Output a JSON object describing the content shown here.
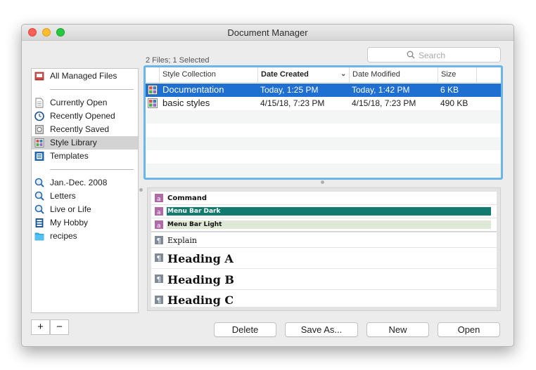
{
  "window": {
    "title": "Document Manager"
  },
  "search": {
    "placeholder": "Search"
  },
  "file_count": "2 Files; 1 Selected",
  "sidebar": {
    "group1": [
      {
        "label": "All Managed Files",
        "icon": "managed-files-icon"
      }
    ],
    "group2": [
      {
        "label": "Currently Open",
        "icon": "document-icon"
      },
      {
        "label": "Recently Opened",
        "icon": "clock-icon"
      },
      {
        "label": "Recently Saved",
        "icon": "saved-icon"
      },
      {
        "label": "Style Library",
        "icon": "style-library-icon",
        "selected": true
      },
      {
        "label": "Templates",
        "icon": "template-icon"
      }
    ],
    "group3": [
      {
        "label": "Jan.-Dec. 2008",
        "icon": "smart-search-icon"
      },
      {
        "label": "Letters",
        "icon": "smart-search-icon"
      },
      {
        "label": "Live or Life",
        "icon": "smart-search-icon"
      },
      {
        "label": "My Hobby",
        "icon": "stack-icon"
      },
      {
        "label": "recipes",
        "icon": "folder-icon"
      }
    ]
  },
  "table": {
    "columns": [
      "Style Collection",
      "Date Created",
      "Date Modified",
      "Size"
    ],
    "sorted_column": "Date Created",
    "rows": [
      {
        "name": "Documentation",
        "created": "Today, 1:25 PM",
        "modified": "Today, 1:42 PM",
        "size": "6 KB",
        "selected": true
      },
      {
        "name": "basic styles",
        "created": "4/15/18, 7:23 PM",
        "modified": "4/15/18, 7:23 PM",
        "size": "490 KB",
        "selected": false
      }
    ]
  },
  "preview": {
    "char_styles": [
      {
        "label": "Command",
        "bar_color": ""
      },
      {
        "label": "Menu Bar Dark",
        "bar_color": "#127a6e"
      },
      {
        "label": "Menu Bar Light",
        "bar_color": "#dfe8d5"
      }
    ],
    "para_styles": [
      {
        "label": "Explain"
      },
      {
        "label": "Heading A"
      },
      {
        "label": "Heading B"
      },
      {
        "label": "Heading C"
      }
    ]
  },
  "buttons": {
    "add": "+",
    "remove": "−",
    "delete": "Delete",
    "save_as": "Save As...",
    "new": "New",
    "open": "Open"
  },
  "colors": {
    "accent": "#1e6fd0",
    "focus_ring": "#6ab6e8"
  }
}
